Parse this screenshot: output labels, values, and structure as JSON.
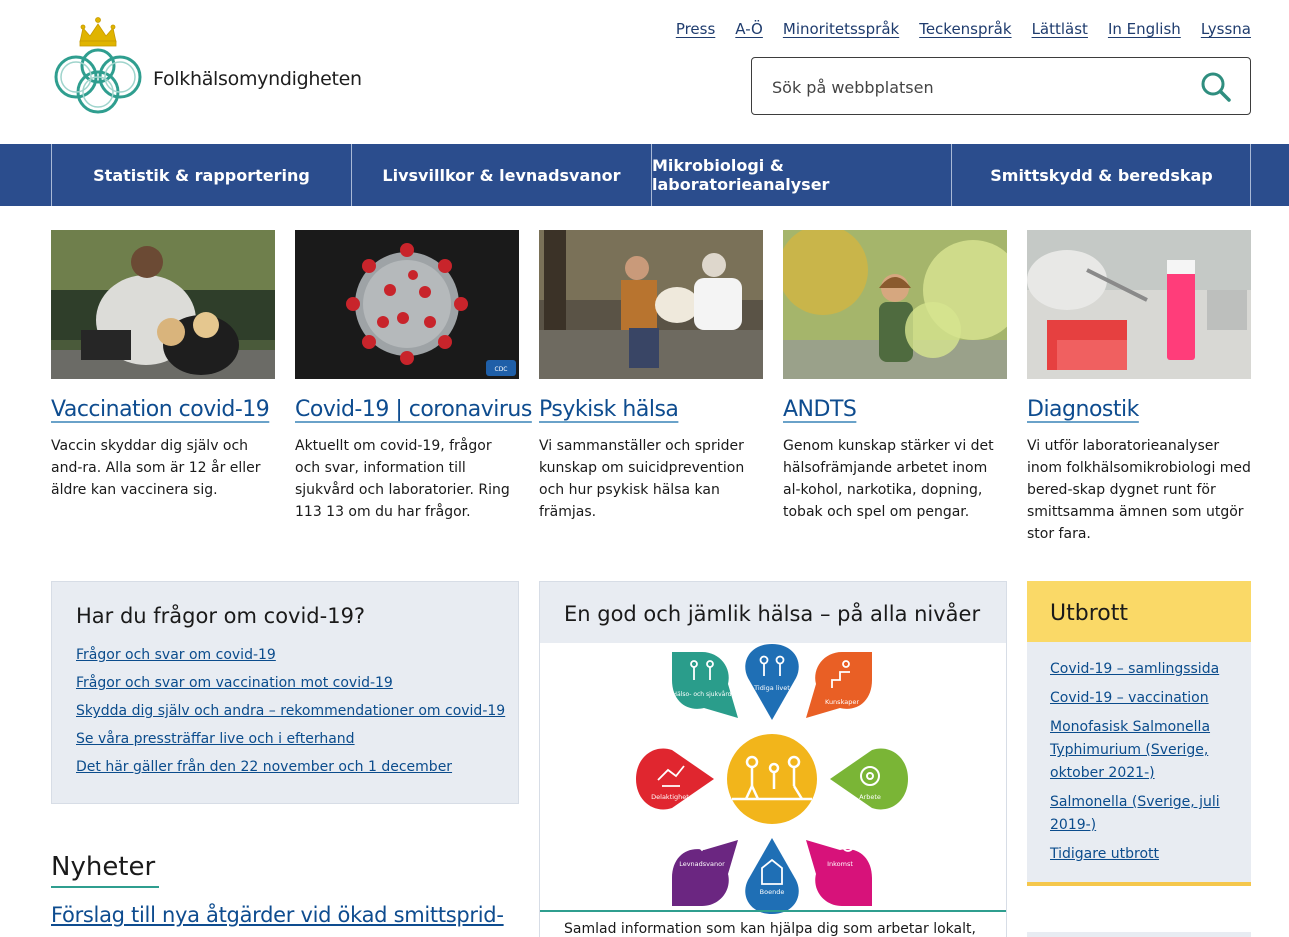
{
  "brand": {
    "name": "Folkhälsomyndigheten"
  },
  "toplinks": [
    "Press",
    "A-Ö",
    "Minoritetsspråk",
    "Teckenspråk",
    "Lättläst",
    "In English",
    "Lyssna"
  ],
  "search": {
    "placeholder": "Sök på webbplatsen",
    "icon": "search-icon"
  },
  "nav": [
    "Statistik & rapportering",
    "Livsvillkor & levnadsvanor",
    "Mikrobiologi & laboratorieanalyser",
    "Smittskydd & beredskap"
  ],
  "cards": [
    {
      "title": "Vaccination covid-19",
      "text": "Vaccin skyddar dig själv och and-ra. Alla som är 12 år eller äldre kan vaccinera sig."
    },
    {
      "title": "Covid-19 | coronavirus",
      "text": "Aktuellt om covid-19, frågor och svar, information till sjukvård och laboratorier. Ring 113 13 om du har frågor."
    },
    {
      "title": "Psykisk hälsa",
      "text": "Vi sammanställer och sprider kunskap om suicidprevention och hur psykisk hälsa kan främjas."
    },
    {
      "title": "ANDTS",
      "text": "Genom kunskap stärker vi det hälsofrämjande arbetet inom al-kohol, narkotika, dopning, tobak och spel om pengar."
    },
    {
      "title": "Diagnostik",
      "text": "Vi utför laboratorieanalyser inom folkhälsomikrobiologi med bered-skap dygnet runt för smittsamma ämnen som utgör stor fara."
    }
  ],
  "covid_box": {
    "title": "Har du frågor om covid-19?",
    "links": [
      "Frågor och svar om covid-19",
      "Frågor och svar om vaccination mot covid-19",
      "Skydda dig själv och andra – rekommendationer om covid-19",
      "Se våra pressträffar live och i efterhand",
      "Det här gäller från den 22 november och 1 december"
    ]
  },
  "health_box": {
    "title": "En god och jämlik hälsa – på alla nivåer",
    "segments": [
      "Tidiga livet",
      "Kunskaper",
      "Arbete",
      "Inkomst",
      "Boende",
      "Levnadsvanor",
      "Delaktighet",
      "Hälso- och sjukvård"
    ],
    "caption": "Samlad information som kan hjälpa dig som arbetar lokalt,"
  },
  "outbreak_box": {
    "title": "Utbrott",
    "links": [
      "Covid-19 – samlingssida",
      "Covid-19 – vaccination",
      "Monofasisk Salmonella Typhimurium (Sverige, oktober 2021-)",
      "Salmonella (Sverige, juli 2019-)",
      "Tidigare utbrott"
    ]
  },
  "news": {
    "heading": "Nyheter",
    "first": "Förslag till nya åtgärder vid ökad smittsprid-"
  },
  "colors": {
    "nav": "#2b4d8d",
    "link": "#0b4c8c",
    "accent_green": "#2f9e8f",
    "outbreak_yellow": "#fad967"
  }
}
